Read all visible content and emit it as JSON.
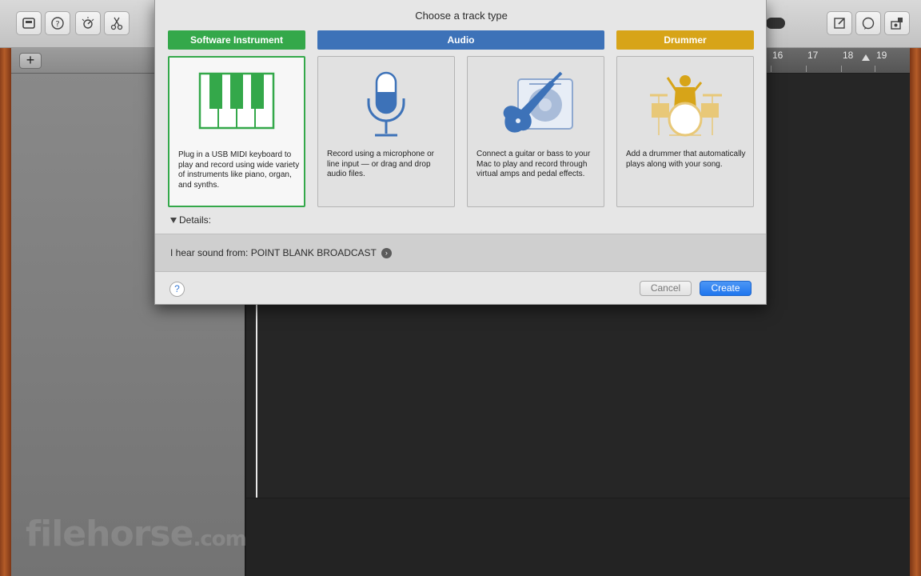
{
  "toolbar": {
    "left_buttons": [
      "library-icon",
      "help-icon",
      "smart-controls-icon",
      "editor-scissors-icon"
    ],
    "right_buttons": [
      "note-pad-icon",
      "loops-icon",
      "media-browser-icon"
    ]
  },
  "track_panel": {
    "add_label": "+"
  },
  "ruler": {
    "numbers": [
      "16",
      "17",
      "18",
      "19"
    ]
  },
  "dialog": {
    "title": "Choose a track type",
    "categories": {
      "software_instrument": "Software Instrument",
      "audio": "Audio",
      "drummer": "Drummer"
    },
    "cards": [
      {
        "icon": "piano-keyboard-icon",
        "text": "Plug in a USB MIDI keyboard to play and record using wide variety of instruments like piano, organ, and synths.",
        "selected": true
      },
      {
        "icon": "microphone-icon",
        "text": "Record using a microphone or line input — or drag and drop audio files.",
        "selected": false
      },
      {
        "icon": "guitar-amp-icon",
        "text": "Connect a guitar or bass to your Mac to play and record through virtual amps and pedal effects.",
        "selected": false
      },
      {
        "icon": "drummer-icon",
        "text": "Add a drummer that automatically plays along with your song.",
        "selected": false
      }
    ],
    "details_label": "Details:",
    "sound_from_label": "I hear sound from: POINT BLANK BROADCAST",
    "help_label": "?",
    "cancel_label": "Cancel",
    "create_label": "Create"
  },
  "watermark": {
    "main": "filehorse",
    "suffix": ".com"
  },
  "colors": {
    "software_instrument": "#34a84a",
    "audio": "#3d72b8",
    "drummer": "#d7a418",
    "create_button": "#1f76ee"
  }
}
